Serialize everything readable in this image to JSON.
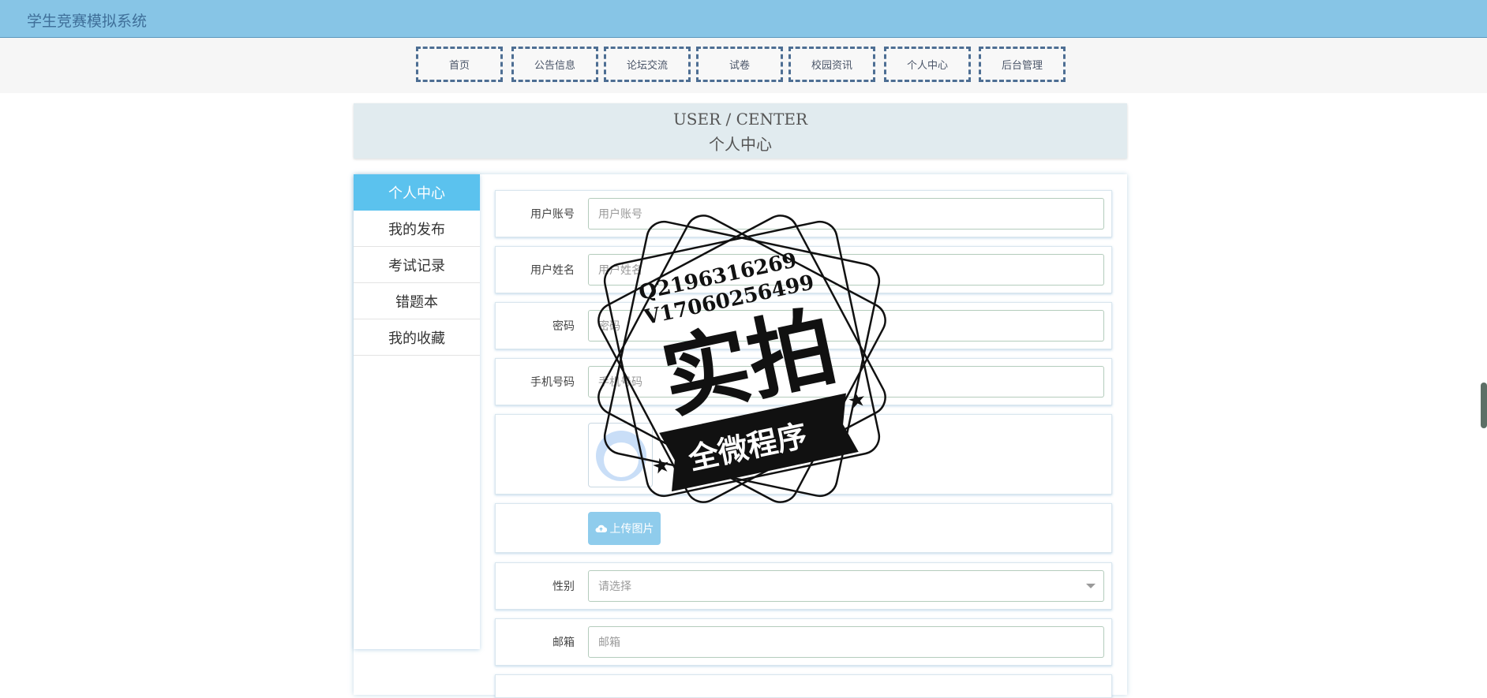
{
  "app": {
    "title": "学生竞赛模拟系统"
  },
  "nav": {
    "items": [
      {
        "label": "首页"
      },
      {
        "label": "公告信息"
      },
      {
        "label": "论坛交流"
      },
      {
        "label": "试卷"
      },
      {
        "label": "校园资讯"
      },
      {
        "label": "个人中心"
      },
      {
        "label": "后台管理"
      }
    ]
  },
  "header": {
    "en_title": "USER / CENTER",
    "zh_title": "个人中心"
  },
  "sidebar": {
    "items": [
      {
        "label": "个人中心",
        "active": true
      },
      {
        "label": "我的发布",
        "active": false
      },
      {
        "label": "考试记录",
        "active": false
      },
      {
        "label": "错题本",
        "active": false
      },
      {
        "label": "我的收藏",
        "active": false
      }
    ]
  },
  "form": {
    "username": {
      "label": "用户账号",
      "placeholder": "用户账号"
    },
    "name": {
      "label": "用户姓名",
      "placeholder": "用户姓名"
    },
    "password": {
      "label": "密码",
      "placeholder": "密码"
    },
    "phone": {
      "label": "手机号码",
      "placeholder": "手机号码"
    },
    "upload": {
      "label": "上传图片"
    },
    "gender": {
      "label": "性别",
      "placeholder": "请选择"
    },
    "email": {
      "label": "邮箱",
      "placeholder": "邮箱"
    }
  },
  "watermark": {
    "line1": "Q2196316269",
    "line2": "V17060256499",
    "main": "实拍",
    "banner": "全微程序"
  },
  "colors": {
    "topbar": "#87c5e6",
    "accent": "#5bc2ee",
    "nav_border": "#4d6e93",
    "upload": "#8fccec"
  }
}
